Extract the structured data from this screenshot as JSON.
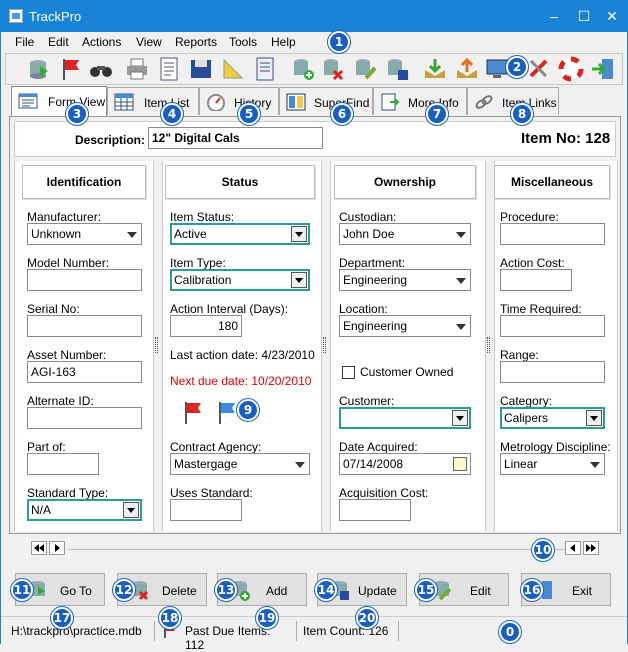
{
  "window": {
    "title": "TrackPro",
    "minimize": "‒",
    "maximize": "☐",
    "close": "✕"
  },
  "menu": [
    "File",
    "Edit",
    "Actions",
    "View",
    "Reports",
    "Tools",
    "Help"
  ],
  "toolbar_icons": [
    "open-db-icon",
    "flag-icon",
    "binoculars-icon",
    "printer-icon",
    "document-icon",
    "save-disk-icon",
    "ruler-icon",
    "notebook-icon",
    "add-record-icon",
    "delete-record-icon",
    "edit-record-icon",
    "update-record-icon",
    "import-icon",
    "export-icon",
    "computer-icon",
    "remove-icon",
    "help-lifebuoy-icon",
    "exit-icon"
  ],
  "tabs": [
    {
      "label": "Form View",
      "icon": "form-view-icon",
      "active": true
    },
    {
      "label": "Item List",
      "icon": "calendar-grid-icon"
    },
    {
      "label": "History",
      "icon": "gauge-icon"
    },
    {
      "label": "SuperFind",
      "icon": "superfind-icon"
    },
    {
      "label": "More Info",
      "icon": "more-info-icon"
    },
    {
      "label": "Item Links",
      "icon": "link-icon"
    }
  ],
  "description": {
    "label": "Description:",
    "value": "12\" Digital Cals"
  },
  "item_no": "Item No: 128",
  "sections": {
    "identification": "Identification",
    "status": "Status",
    "ownership": "Ownership",
    "miscellaneous": "Miscellaneous"
  },
  "identification": {
    "manufacturer_label": "Manufacturer:",
    "manufacturer": "Unknown",
    "model_label": "Model Number:",
    "model": "",
    "serial_label": "Serial No:",
    "serial": "",
    "asset_label": "Asset Number:",
    "asset": "AGI-163",
    "alternate_label": "Alternate ID:",
    "alternate": "",
    "partof_label": "Part of:",
    "partof": "",
    "standard_label": "Standard Type:",
    "standard": "N/A"
  },
  "status": {
    "item_status_label": "Item Status:",
    "item_status": "Active",
    "item_type_label": "Item Type:",
    "item_type": "Calibration",
    "interval_label": "Action Interval (Days):",
    "interval": "180",
    "last_action": "Last action date: 4/23/2010",
    "next_due": "Next due date: 10/20/2010",
    "contract_label": "Contract Agency:",
    "contract": "Mastergage",
    "uses_label": "Uses Standard:",
    "uses": ""
  },
  "ownership": {
    "custodian_label": "Custodian:",
    "custodian": "John Doe",
    "department_label": "Department:",
    "department": "Engineering",
    "location_label": "Location:",
    "location": "Engineering",
    "customer_owned_label": "Customer Owned",
    "customer_label": "Customer:",
    "customer": "",
    "date_acquired_label": "Date Acquired:",
    "date_acquired": "07/14/2008",
    "acq_cost_label": "Acquisition Cost:",
    "acq_cost": ""
  },
  "misc": {
    "procedure_label": "Procedure:",
    "procedure": "",
    "action_cost_label": "Action Cost:",
    "action_cost": "",
    "time_label": "Time Required:",
    "time": "",
    "range_label": "Range:",
    "range": "",
    "category_label": "Category:",
    "category": "Calipers",
    "metrology_label": "Metrology Discipline:",
    "metrology": "Linear"
  },
  "buttons": {
    "goto": "Go To",
    "delete": "Delete",
    "add": "Add",
    "update": "Update",
    "edit": "Edit",
    "exit": "Exit"
  },
  "statusbar": {
    "path": "H:\\trackpro\\practice.mdb",
    "past_due": "Past Due Items: 112",
    "count": "Item Count: 126"
  },
  "badges": [
    "1",
    "2",
    "3",
    "4",
    "5",
    "6",
    "7",
    "8",
    "9",
    "10",
    "11",
    "12",
    "13",
    "14",
    "15",
    "16",
    "17",
    "18",
    "19",
    "20",
    "0"
  ],
  "colors": {
    "accent": "#1883d7",
    "badge": "#1a5fc0",
    "due": "#e00000",
    "focus": "#2a9d8f"
  }
}
